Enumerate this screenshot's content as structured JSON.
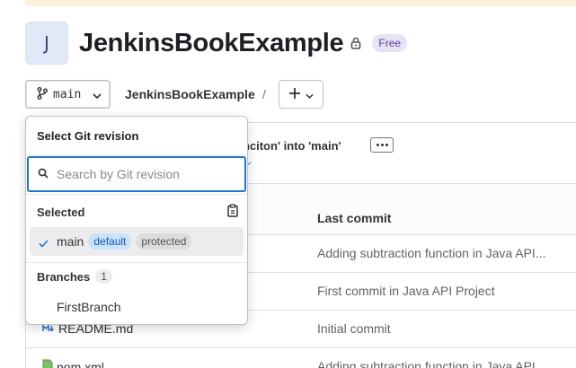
{
  "project": {
    "avatar_letter": "J",
    "title": "JenkinsBookExample",
    "visibility_icon": "lock-icon",
    "tier_badge": "Free"
  },
  "nav": {
    "branch_icon": "branch-icon",
    "branch_label": "main",
    "breadcrumb_project": "JenkinsBookExample",
    "breadcrumb_separator": "/",
    "add_icon": "plus-icon"
  },
  "commit": {
    "message": "unciton' into 'main'"
  },
  "table": {
    "columns": [
      "Last commit"
    ],
    "rows": [
      {
        "name": "",
        "last_commit": "Adding subtraction function in Java API..."
      },
      {
        "name": "",
        "last_commit": "First commit in Java API Project"
      },
      {
        "name": "README.md",
        "icon": "markdown-icon",
        "last_commit": "Initial commit"
      },
      {
        "name": "pom.xml",
        "icon": "file-icon",
        "last_commit": "Adding subtraction function in Java API..."
      }
    ]
  },
  "dropdown": {
    "title": "Select Git revision",
    "search_placeholder": "Search by Git revision",
    "selected_header": "Selected",
    "selected_item": {
      "name": "main",
      "badges": [
        "default",
        "protected"
      ]
    },
    "branches_header": "Branches",
    "branches_count": "1",
    "branches": [
      "FirstBranch"
    ]
  },
  "colors": {
    "accent": "#1f75cb",
    "tier_badge_bg": "#e8e2f5",
    "default_badge_bg": "#cbe2f9",
    "protected_badge_bg": "#dcdcde"
  }
}
